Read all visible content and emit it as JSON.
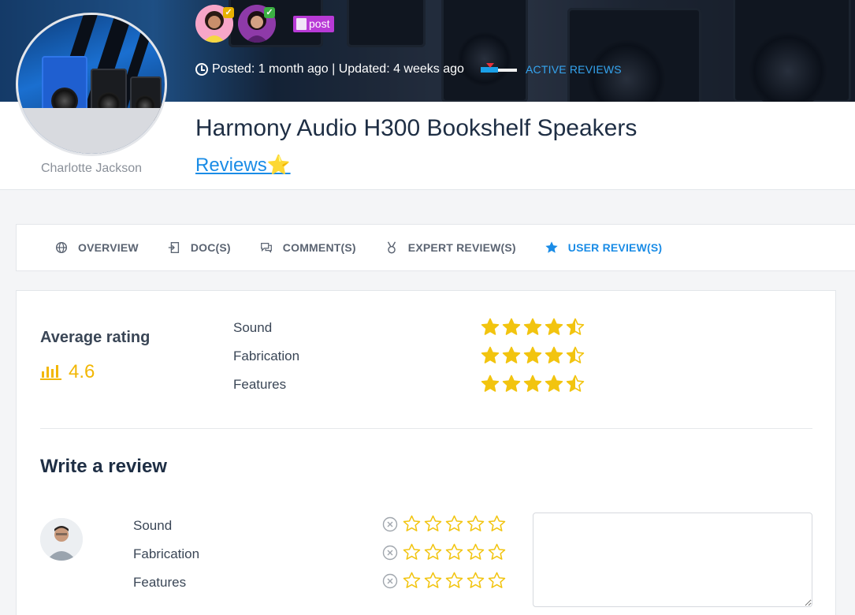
{
  "header": {
    "meta_text": "Posted: 1 month ago | Updated: 4 weeks ago",
    "post_tag": "post",
    "status": "ACTIVE REVIEWS",
    "title": "Harmony Audio H300 Bookshelf Speakers",
    "reviews_link": "Reviews⭐",
    "author": "Charlotte Jackson"
  },
  "tabs": [
    {
      "label": "OVERVIEW",
      "icon": "globe-icon"
    },
    {
      "label": "DOC(S)",
      "icon": "document-import-icon"
    },
    {
      "label": "COMMENT(S)",
      "icon": "comments-icon"
    },
    {
      "label": "EXPERT REVIEW(S)",
      "icon": "medal-icon"
    },
    {
      "label": "USER REVIEW(S)",
      "icon": "star-icon",
      "active": true
    }
  ],
  "average": {
    "label": "Average rating",
    "score": "4.6",
    "criteria": [
      {
        "label": "Sound",
        "rating": 4.5
      },
      {
        "label": "Fabrication",
        "rating": 4.5
      },
      {
        "label": "Features",
        "rating": 4.5
      }
    ]
  },
  "write_review": {
    "title": "Write a review",
    "criteria": [
      {
        "label": "Sound",
        "rating": 0
      },
      {
        "label": "Fabrication",
        "rating": 0
      },
      {
        "label": "Features",
        "rating": 0
      }
    ],
    "textarea_value": ""
  },
  "colors": {
    "accent": "#1a8ce6",
    "star": "#f2c40f",
    "post_tag": "#b83ad6"
  }
}
